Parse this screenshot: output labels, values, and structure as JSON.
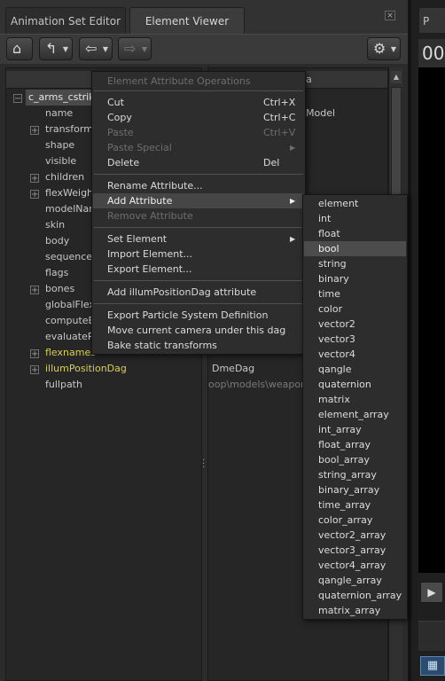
{
  "tabs": {
    "animation_set_editor": "Animation Set Editor",
    "element_viewer": "Element Viewer",
    "close": "×"
  },
  "toolbar": {
    "home_icon": "home-icon",
    "up_icon": "up-arrow-icon",
    "back_icon": "back-arrow-icon",
    "forward_icon": "forward-arrow-icon",
    "settings_icon": "gear-icon"
  },
  "tree": {
    "root": "c_arms_cstrike",
    "items": [
      "name",
      "transform",
      "shape",
      "visible",
      "children",
      "flexWeight",
      "modelName",
      "skin",
      "body",
      "sequence",
      "flags",
      "bones",
      "globalFlexC",
      "computeBo",
      "evaluatePr",
      "flexnames",
      "illumPositionDag",
      "fullpath"
    ]
  },
  "value_column": {
    "header_fragment": "a",
    "model_fragment": "Model",
    "dag_value": "DmeDag",
    "path_value": "oop\\models\\weapons\\"
  },
  "context_menu": {
    "title": "Element Attribute Operations",
    "cut": "Cut",
    "cut_sc": "Ctrl+X",
    "copy": "Copy",
    "copy_sc": "Ctrl+C",
    "paste": "Paste",
    "paste_sc": "Ctrl+V",
    "paste_special": "Paste Special",
    "delete": "Delete",
    "delete_sc": "Del",
    "rename": "Rename Attribute...",
    "add": "Add Attribute",
    "remove": "Remove Attribute",
    "set_element": "Set Element",
    "import_element": "Import Element...",
    "export_element": "Export Element...",
    "add_illum": "Add illumPositionDag attribute",
    "export_particle": "Export Particle System Definition",
    "move_camera": "Move current camera under this dag",
    "bake": "Bake static transforms",
    "submenu_arrow": "▶"
  },
  "submenu": {
    "items": [
      "element",
      "int",
      "float",
      "bool",
      "string",
      "binary",
      "time",
      "color",
      "vector2",
      "vector3",
      "vector4",
      "qangle",
      "quaternion",
      "matrix",
      "element_array",
      "int_array",
      "float_array",
      "bool_array",
      "string_array",
      "binary_array",
      "time_array",
      "color_array",
      "vector2_array",
      "vector3_array",
      "vector4_array",
      "qangle_array",
      "quaternion_array",
      "matrix_array"
    ],
    "highlighted": "bool"
  },
  "right_edge": {
    "tab_fragment": "P",
    "big_text": "00"
  },
  "colors": {
    "background": "#2b2b2b",
    "highlight_tree": "#d8cf52",
    "menu_bg": "#2d2d2d",
    "film_icon": "#2b4c6e"
  }
}
